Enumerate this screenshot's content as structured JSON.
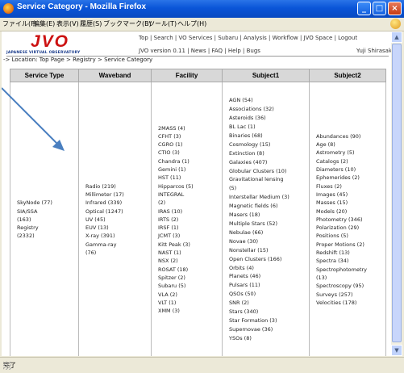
{
  "window": {
    "title": "Service Category - Mozilla Firefox"
  },
  "menu": [
    "ファイル(F)",
    "編集(E)",
    "表示(V)",
    "履歴(S)",
    "ブックマーク(B)",
    "ツール(T)",
    "ヘルプ(H)"
  ],
  "header": {
    "logo_text": "JVO",
    "logo_sub": "JAPANESE VIRTUAL OBSERVATORY",
    "toplinks": "Top | Search | VO Services | Subaru | Analysis | Workflow | JVO Space | Logout",
    "version": "JVO version 0.11 | News | FAQ | Help | Bugs",
    "user": "Yuji Shirasaki"
  },
  "breadcrumb": "-> Location: Top Page > Registry > Service Category",
  "table": {
    "headers": [
      "Service Type",
      "Waveband",
      "Facility",
      "Subject1",
      "Subject2"
    ],
    "service_type": [
      "SkyNode (77)",
      "SIA/SSA",
      "(163)",
      "Registry",
      "(2332)"
    ],
    "waveband": [
      "Radio (219)",
      "Millimeter (17)",
      "Infrared (339)",
      "Optical (1247)",
      "UV (45)",
      "EUV (13)",
      "X-ray (391)",
      "Gamma-ray",
      "(76)"
    ],
    "facility": [
      "2MASS (4)",
      "CFHT (3)",
      "CGRO (1)",
      "CTIO (3)",
      "Chandra (1)",
      "Gemini (1)",
      "HST (11)",
      "Hipparcos (5)",
      "INTEGRAL",
      "(2)",
      "IRAS (10)",
      "IRTS (2)",
      "IRSF (1)",
      "JCMT (3)",
      "Kitt Peak (3)",
      "NAST (1)",
      "NSX (2)",
      "ROSAT (18)",
      "Spitzer (2)",
      "Subaru (5)",
      "VLA (2)",
      "VLT (1)",
      "XMM (3)"
    ],
    "subject1": [
      "AGN (54)",
      "Associations (32)",
      "Asteroids (36)",
      "BL Lac (1)",
      "Binaries (68)",
      "Cosmology (15)",
      "Extinction (8)",
      "Galaxies (407)",
      "Globular Clusters (10)",
      "Gravitational lensing",
      "(5)",
      "Interstellar Medium (3)",
      "Magnetic fields (6)",
      "Masers (18)",
      "Multiple Stars (52)",
      "Nebulae (66)",
      "Novae (30)",
      "Nonstellar (15)",
      "Open Clusters (166)",
      "Orbits (4)",
      "Planets (46)",
      "Pulsars (11)",
      "QSOs (50)",
      "SNR (2)",
      "Stars (340)",
      "Star Formation (3)",
      "Supernovae (36)",
      "YSOs (8)"
    ],
    "subject2": [
      "Abundances (90)",
      "Age (8)",
      "Astrometry (5)",
      "Catalogs (2)",
      "Diameters (10)",
      "Ephemerides (2)",
      "Fluxes (2)",
      "Images (45)",
      "Masses (15)",
      "Models (20)",
      "Photometry (346)",
      "Polarization (29)",
      "Positions (5)",
      "Proper Motions (2)",
      "Redshift (13)",
      "Spectra (34)",
      "Spectrophotometry",
      "(13)",
      "Spectroscopy (95)",
      "Surveys (257)",
      "Velocities (178)"
    ]
  },
  "status": "完了",
  "colors": {
    "titlebar": "#0a55d8",
    "logo": "#cc1111",
    "arrow": "#4a7fc0"
  }
}
